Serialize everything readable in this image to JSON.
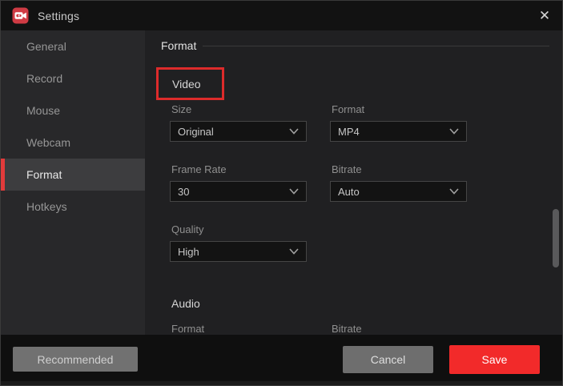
{
  "window": {
    "title": "Settings",
    "close_glyph": "✕"
  },
  "sidebar": {
    "selected": "Format",
    "items": [
      {
        "label": "General"
      },
      {
        "label": "Record"
      },
      {
        "label": "Mouse"
      },
      {
        "label": "Webcam"
      },
      {
        "label": "Format"
      },
      {
        "label": "Hotkeys"
      }
    ]
  },
  "content": {
    "section_title": "Format",
    "video": {
      "title": "Video",
      "highlighted": true,
      "fields": [
        {
          "label": "Size",
          "value": "Original"
        },
        {
          "label": "Format",
          "value": "MP4"
        },
        {
          "label": "Frame Rate",
          "value": "30"
        },
        {
          "label": "Bitrate",
          "value": "Auto"
        },
        {
          "label": "Quality",
          "value": "High"
        }
      ]
    },
    "audio": {
      "title": "Audio",
      "fields": [
        {
          "label": "Format"
        },
        {
          "label": "Bitrate"
        }
      ]
    }
  },
  "footer": {
    "recommended_label": "Recommended",
    "cancel_label": "Cancel",
    "save_label": "Save"
  },
  "colors": {
    "accent_red": "#f22a2a",
    "highlight_border": "#dd2b2b",
    "selected_tab_bg": "#3d3d3f",
    "sidebar_bg": "#28282a",
    "content_bg": "#202022",
    "titlebar_bg": "#121212",
    "footer_bg": "#0f0f0f"
  }
}
